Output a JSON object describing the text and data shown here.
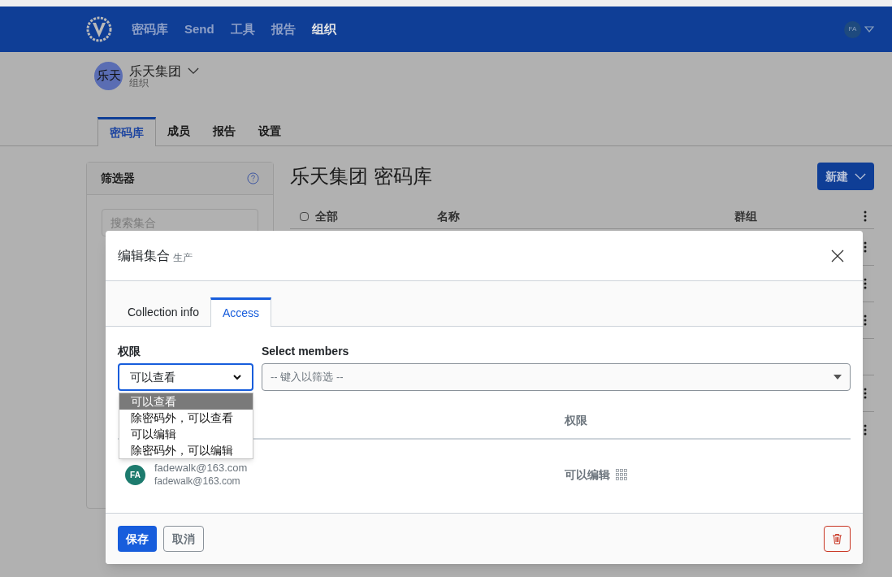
{
  "nav": {
    "items": [
      {
        "label": "密码库",
        "selected": false
      },
      {
        "label": "Send",
        "selected": false
      },
      {
        "label": "工具",
        "selected": false
      },
      {
        "label": "报告",
        "selected": false
      },
      {
        "label": "组织",
        "selected": true
      }
    ],
    "avatar": "FA"
  },
  "org": {
    "avatar": "乐天",
    "name": "乐天集团",
    "subtitle": "组织"
  },
  "org_tabs": [
    {
      "label": "密码库",
      "selected": true
    },
    {
      "label": "成员",
      "selected": false
    },
    {
      "label": "报告",
      "selected": false
    },
    {
      "label": "设置",
      "selected": false
    }
  ],
  "filter": {
    "title": "筛选器",
    "search_placeholder": "搜索集合"
  },
  "vault": {
    "title": "乐天集团 密码库",
    "new_button": "新建",
    "select_all_checked": false,
    "columns": [
      "全部",
      "名称",
      "群组"
    ]
  },
  "dialog": {
    "title": "编辑集合",
    "subtitle": "生产",
    "tabs": [
      {
        "label": "Collection info",
        "selected": false
      },
      {
        "label": "Access",
        "selected": true
      }
    ],
    "permission_label": "权限",
    "permission_value": "可以查看",
    "permission_options": [
      {
        "label": "可以查看",
        "selected": true
      },
      {
        "label": "除密码外，可以查看",
        "selected": false
      },
      {
        "label": "可以编辑",
        "selected": false
      },
      {
        "label": "除密码外，可以编辑",
        "selected": false
      }
    ],
    "members_label": "Select members",
    "members_placeholder": "-- 键入以筛选 --",
    "table_header": "权限",
    "members": [
      {
        "avatar": "FA",
        "name": "fadewalk@163.com",
        "email": "fadewalk@163.com",
        "permission": "可以编辑"
      }
    ],
    "save": "保存",
    "cancel": "取消"
  }
}
